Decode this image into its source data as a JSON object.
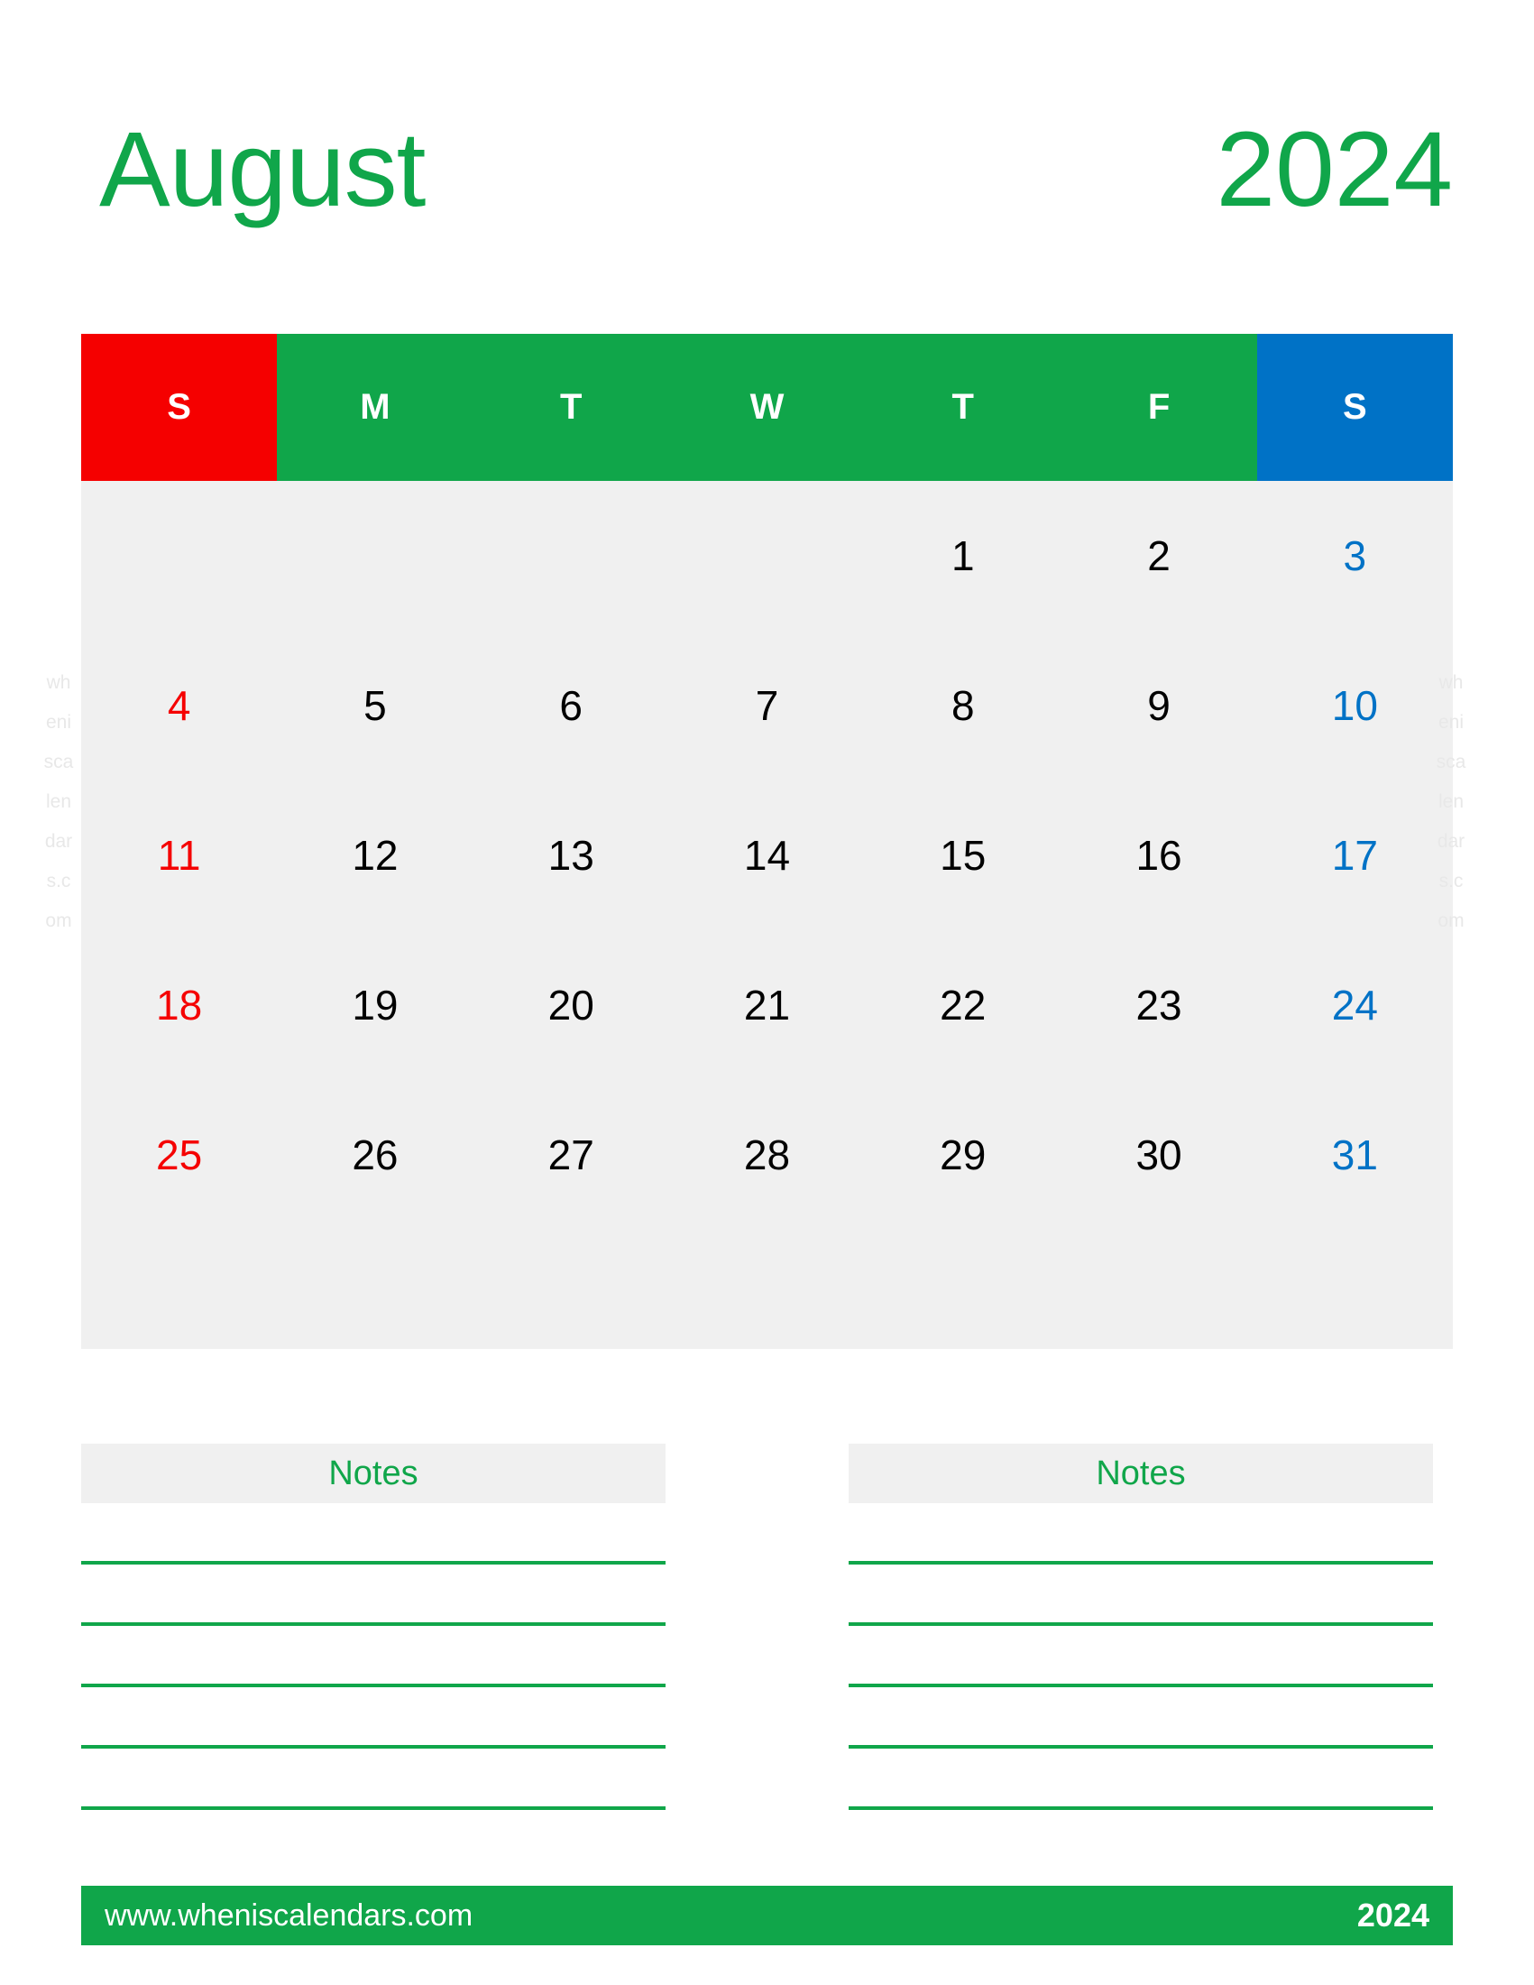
{
  "title": {
    "month": "August",
    "year": "2024"
  },
  "calendar": {
    "weekday_headers": [
      "S",
      "M",
      "T",
      "W",
      "T",
      "F",
      "S"
    ],
    "weeks": [
      [
        "",
        "",
        "",
        "",
        "1",
        "2",
        "3"
      ],
      [
        "4",
        "5",
        "6",
        "7",
        "8",
        "9",
        "10"
      ],
      [
        "11",
        "12",
        "13",
        "14",
        "15",
        "16",
        "17"
      ],
      [
        "18",
        "19",
        "20",
        "21",
        "22",
        "23",
        "24"
      ],
      [
        "25",
        "26",
        "27",
        "28",
        "29",
        "30",
        "31"
      ]
    ],
    "colors": {
      "sunday": "#f50000",
      "saturday": "#0072c6",
      "weekday_header_bg": "#10a64a",
      "cell_bg": "#f0f0f0",
      "accent": "#10a64a"
    }
  },
  "notes": {
    "left_label": "Notes",
    "right_label": "Notes",
    "line_count": 5
  },
  "footer": {
    "url": "www.wheniscalendars.com",
    "year": "2024"
  },
  "watermark": {
    "text": "wheniscalendars.com"
  }
}
